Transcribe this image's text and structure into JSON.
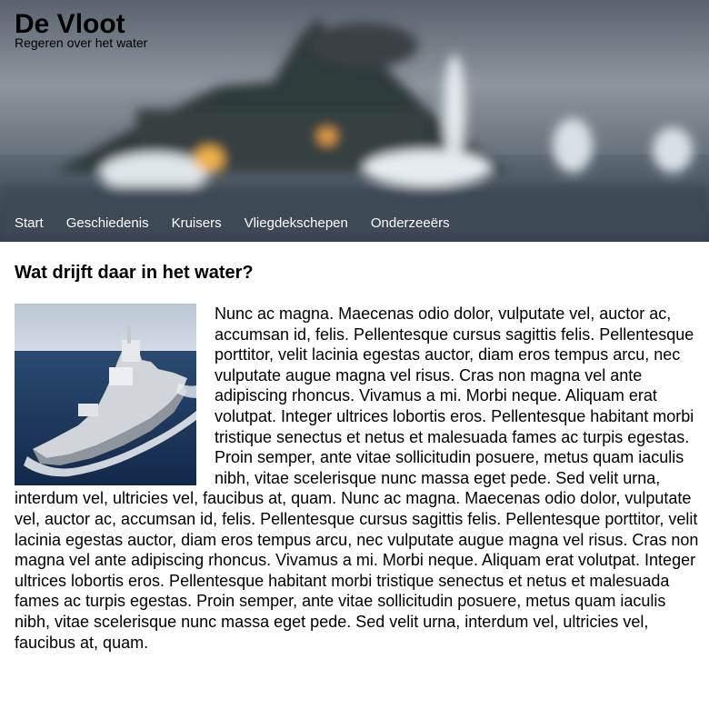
{
  "site": {
    "title": "De Vloot",
    "tagline": "Regeren over het water"
  },
  "nav": {
    "items": [
      {
        "label": "Start"
      },
      {
        "label": "Geschiedenis"
      },
      {
        "label": "Kruisers"
      },
      {
        "label": "Vliegdekschepen"
      },
      {
        "label": "Onderzeeërs"
      }
    ]
  },
  "main": {
    "heading": "Wat drijft daar in het water?",
    "photo_icon": "frigate-photo",
    "body": "Nunc ac magna. Maecenas odio dolor, vulputate vel, auctor ac, accumsan id, felis. Pellentesque cursus sagittis felis. Pellentesque porttitor, velit lacinia egestas auctor, diam eros tempus arcu, nec vulputate augue magna vel risus. Cras non magna vel ante adipiscing rhoncus. Vivamus a mi. Morbi neque. Aliquam erat volutpat. Integer ultrices lobortis eros. Pellentesque habitant morbi tristique senectus et netus et malesuada fames ac turpis egestas. Proin semper, ante vitae sollicitudin posuere, metus quam iaculis nibh, vitae scelerisque nunc massa eget pede. Sed velit urna, interdum vel, ultricies vel, faucibus at, quam. Nunc ac magna. Maecenas odio dolor, vulputate vel, auctor ac, accumsan id, felis. Pellentesque cursus sagittis felis. Pellentesque porttitor, velit lacinia egestas auctor, diam eros tempus arcu, nec vulputate augue magna vel risus. Cras non magna vel ante adipiscing rhoncus. Vivamus a mi. Morbi neque. Aliquam erat volutpat. Integer ultrices lobortis eros. Pellentesque habitant morbi tristique senectus et netus et malesuada fames ac turpis egestas. Proin semper, ante vitae sollicitudin posuere, metus quam iaculis nibh, vitae scelerisque nunc massa eget pede. Sed velit urna, interdum vel, ultricies vel, faucibus at, quam."
  },
  "colors": {
    "nav_text": "#ffffff",
    "sea": "#1f3c63"
  }
}
